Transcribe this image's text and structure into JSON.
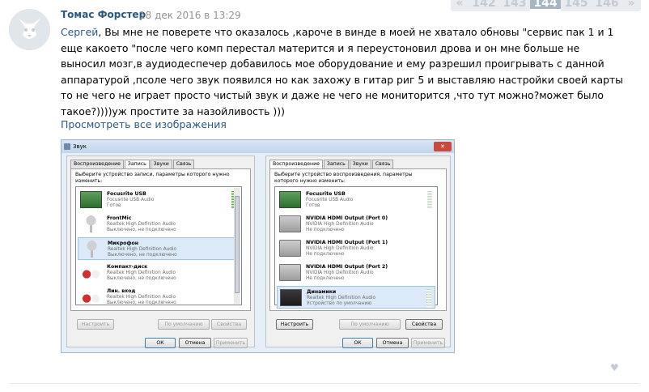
{
  "pagination": {
    "prev": "«",
    "next": "»",
    "pages": [
      "142",
      "143",
      "144",
      "145",
      "146"
    ],
    "current": "144"
  },
  "post": {
    "author": "Томас Форстер",
    "date": "18 дек 2016 в 13:29",
    "mention": "Сергей",
    "body": ", Вы мне не поверете что оказалось ,кароче в винде в моей не хватало обновы \"сервис пак 1 и 1 еще какоето \"после чего комп перестал матерится и я переустоновил дрова и он мне больше не выносил мозг,в аудиодеспечер добавилось мое оборудование и ему разрешил проигрывать с данной аппаратурой ,псоле чего звук появился но как захожу в гитар риг 5 и выставляю настройки своей карты то не чего не играет просто чистый звук и даже не чего не мониторится ,что тут можно?может было такое?))))уж простите за назойливость )))",
    "view_all_images": "Просмотреть все изображения"
  },
  "shot_left": {
    "title": "Звук",
    "close": "✕",
    "tabs": [
      "Воспроизведение",
      "Запись",
      "Звуки",
      "Связь"
    ],
    "active_tab": 1,
    "hint": "Выберите устройство записи, параметры которого нужно изменить:",
    "devices": [
      {
        "name": "Focusrite USB",
        "line1": "Focusrite USB Audio",
        "line2": "Готов"
      },
      {
        "name": "FrontMic",
        "line1": "Realtek High Definition Audio",
        "line2": "Выключено, не подключено"
      },
      {
        "name": "Микрофон",
        "line1": "Realtek High Definition Audio",
        "line2": "Выключено, не подключено"
      },
      {
        "name": "Компакт-диск",
        "line1": "Realtek High Definition Audio",
        "line2": "Выключено, не подключено"
      },
      {
        "name": "Лин. вход",
        "line1": "Realtek High Definition Audio",
        "line2": "Выключено, не подключено"
      }
    ],
    "btn_configure": "Настроить",
    "btn_default": "По умолчанию",
    "btn_properties": "Свойства",
    "btn_ok": "ОК",
    "btn_cancel": "Отмена",
    "btn_apply": "Применить"
  },
  "shot_right": {
    "title": "Звук",
    "close": "✕",
    "tabs": [
      "Воспроизведение",
      "Запись",
      "Звуки",
      "Связь"
    ],
    "active_tab": 0,
    "hint": "Выберите устройство воспроизведения, параметры которого нужно изменить:",
    "devices": [
      {
        "name": "Focusrite USB",
        "line1": "Focusrite USB Audio",
        "line2": "Готов"
      },
      {
        "name": "NVIDIA HDMI Output (Port 0)",
        "line1": "NVIDIA High Definition Audio",
        "line2": "Не подключено"
      },
      {
        "name": "NVIDIA HDMI Output (Port 1)",
        "line1": "NVIDIA High Definition Audio",
        "line2": "Не подключено"
      },
      {
        "name": "NVIDIA HDMI Output (Port 2)",
        "line1": "NVIDIA High Definition Audio",
        "line2": "Не подключено"
      },
      {
        "name": "Динамики",
        "line1": "Realtek High Definition Audio",
        "line2": "Устройство по умолчанию"
      }
    ],
    "btn_configure": "Настроить",
    "btn_default": "По умолчанию",
    "btn_properties": "Свойства",
    "btn_ok": "ОК",
    "btn_cancel": "Отмена",
    "btn_apply": "Применить"
  },
  "like_icon": "heart-icon"
}
